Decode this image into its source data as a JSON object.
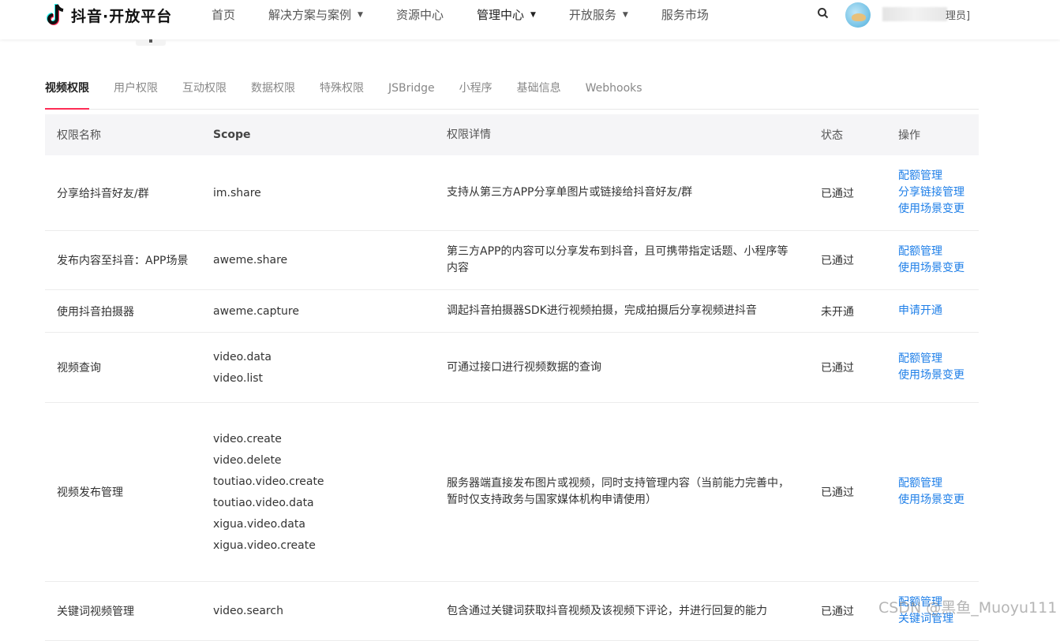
{
  "header": {
    "logo_text": "抖音·开放平台",
    "nav": [
      {
        "label": "首页",
        "dropdown": false,
        "dark": false
      },
      {
        "label": "解决方案与案例",
        "dropdown": true,
        "dark": false
      },
      {
        "label": "资源中心",
        "dropdown": false,
        "dark": false
      },
      {
        "label": "管理中心",
        "dropdown": true,
        "dark": true
      },
      {
        "label": "开放服务",
        "dropdown": true,
        "dark": false
      },
      {
        "label": "服务市场",
        "dropdown": false,
        "dark": false
      }
    ],
    "username_suffix": "理员]"
  },
  "tabs": [
    "视频权限",
    "用户权限",
    "互动权限",
    "数据权限",
    "特殊权限",
    "JSBridge",
    "小程序",
    "基础信息",
    "Webhooks"
  ],
  "active_tab": "视频权限",
  "table": {
    "headers": [
      "权限名称",
      "Scope",
      "权限详情",
      "状态",
      "操作"
    ],
    "rows": [
      {
        "name": "分享给抖音好友/群",
        "scopes": [
          "im.share"
        ],
        "detail": "支持从第三方APP分享单图片或链接给抖音好友/群",
        "status": "已通过",
        "ops": [
          "配额管理",
          "分享链接管理",
          "使用场景变更"
        ]
      },
      {
        "name": "发布内容至抖音：APP场景",
        "scopes": [
          "aweme.share"
        ],
        "detail": "第三方APP的内容可以分享发布到抖音，且可携带指定话题、小程序等内容",
        "status": "已通过",
        "ops": [
          "配额管理",
          "使用场景变更"
        ]
      },
      {
        "name": "使用抖音拍摄器",
        "scopes": [
          "aweme.capture"
        ],
        "detail": "调起抖音拍摄器SDK进行视频拍摄，完成拍摄后分享视频进抖音",
        "status": "未开通",
        "ops": [
          "申请开通"
        ]
      },
      {
        "name": "视频查询",
        "scopes": [
          "video.data",
          "video.list"
        ],
        "detail": "可通过接口进行视频数据的查询",
        "status": "已通过",
        "ops": [
          "配额管理",
          "使用场景变更"
        ]
      },
      {
        "name": "视频发布管理",
        "scopes": [
          "video.create",
          "video.delete",
          "toutiao.video.create",
          "toutiao.video.data",
          "xigua.video.data",
          "xigua.video.create"
        ],
        "detail": "服务器端直接发布图片或视频，同时支持管理内容（当前能力完善中，暂时仅支持政务与国家媒体机构申请使用）",
        "status": "已通过",
        "ops": [
          "配额管理",
          "使用场景变更"
        ]
      },
      {
        "name": "关键词视频管理",
        "scopes": [
          "video.search"
        ],
        "detail": "包含通过关键词获取抖音视频及该视频下评论，并进行回复的能力",
        "status": "已通过",
        "ops": [
          "配额管理",
          "关键词管理"
        ]
      }
    ]
  },
  "watermark": "CSDN @黑鱼_Muoyu111",
  "colors": {
    "accent": "#fe2c55",
    "link": "#1f7fe8",
    "header_bg": "#f5f5f7"
  }
}
